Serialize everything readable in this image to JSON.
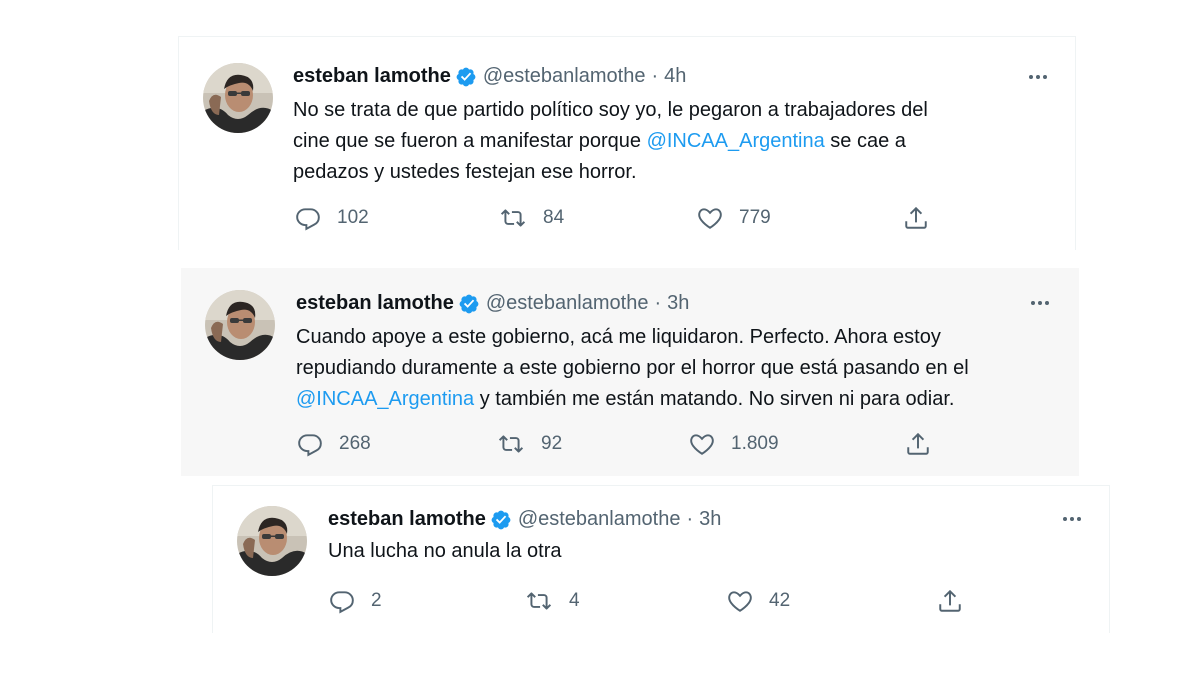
{
  "colors": {
    "link": "#1d9bf0",
    "secondary": "#536471",
    "text": "#0f1419",
    "verified": "#1d9bf0"
  },
  "tweets": [
    {
      "name": "esteban lamothe",
      "handle": "@estebanlamothe",
      "separator": "·",
      "time": "4h",
      "text_lines": [
        "No se trata de que partido político soy yo, le pegaron a trabajadores del",
        "cine que se fueron a manifestar porque ",
        "pedazos y ustedes festejan ese horror."
      ],
      "mention": "@INCAA_Argentina",
      "line2_after": " se cae a",
      "reply_count": "102",
      "retweet_count": "84",
      "like_count": "779"
    },
    {
      "name": "esteban lamothe",
      "handle": "@estebanlamothe",
      "separator": "·",
      "time": "3h",
      "text_lines": [
        "Cuando apoye a este gobierno, acá me liquidaron. Perfecto. Ahora  estoy",
        "repudiando duramente a este gobierno por el horror que está pasando en el",
        " y también me están matando. No sirven ni para odiar."
      ],
      "mention": "@INCAA_Argentina",
      "reply_count": "268",
      "retweet_count": "92",
      "like_count": "1.809"
    },
    {
      "name": "esteban lamothe",
      "handle": "@estebanlamothe",
      "separator": "·",
      "time": "3h",
      "text_lines": [
        "Una lucha no anula la otra"
      ],
      "reply_count": "2",
      "retweet_count": "4",
      "like_count": "42"
    }
  ],
  "icons": {
    "verified": "verified-badge-icon",
    "more": "more-options-icon",
    "reply": "reply-icon",
    "retweet": "retweet-icon",
    "like": "heart-icon",
    "share": "share-icon"
  }
}
